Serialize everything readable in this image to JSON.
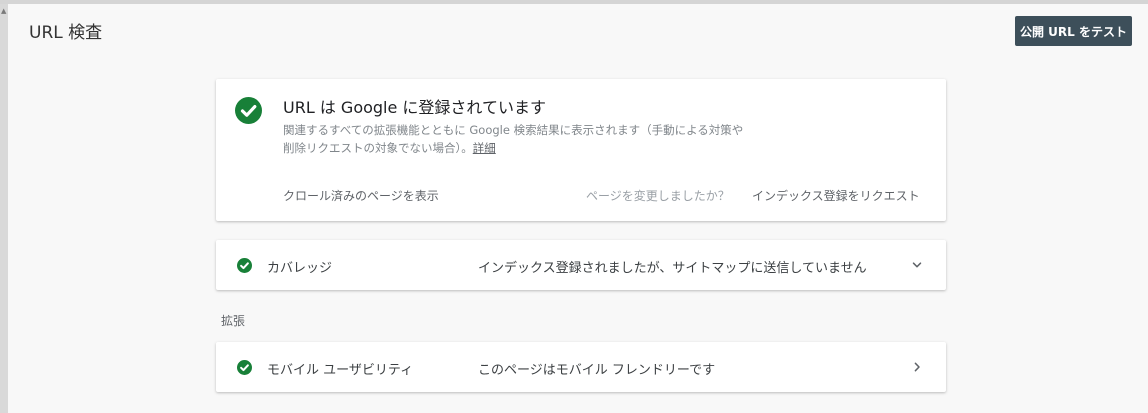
{
  "header": {
    "title": "URL 検査",
    "test_button": "公開 URL をテスト"
  },
  "status": {
    "icon": "check-circle-icon",
    "title": "URL は Google に登録されています",
    "description": "関連するすべての拡張機能とともに Google 検索結果に表示されます（手動による対策や削除リクエストの対象でない場合）。",
    "detail_link": "詳細",
    "crawled_page_link": "クロール済みのページを表示",
    "changed_question": "ページを変更しましたか？",
    "request_index_link": "インデックス登録をリクエスト"
  },
  "coverage": {
    "icon": "check-circle-icon",
    "label": "カバレッジ",
    "value": "インデックス登録されましたが、サイトマップに送信していません",
    "chevron": "chevron-down-icon"
  },
  "enhancements": {
    "section_label": "拡張",
    "mobile_usability": {
      "icon": "check-circle-icon",
      "label": "モバイル ユーザビリティ",
      "value": "このページはモバイル フレンドリーです",
      "chevron": "chevron-right-icon"
    }
  },
  "colors": {
    "success": "#188038",
    "button_bg": "#3d4f5a",
    "page_bg": "#f8f8f8"
  }
}
